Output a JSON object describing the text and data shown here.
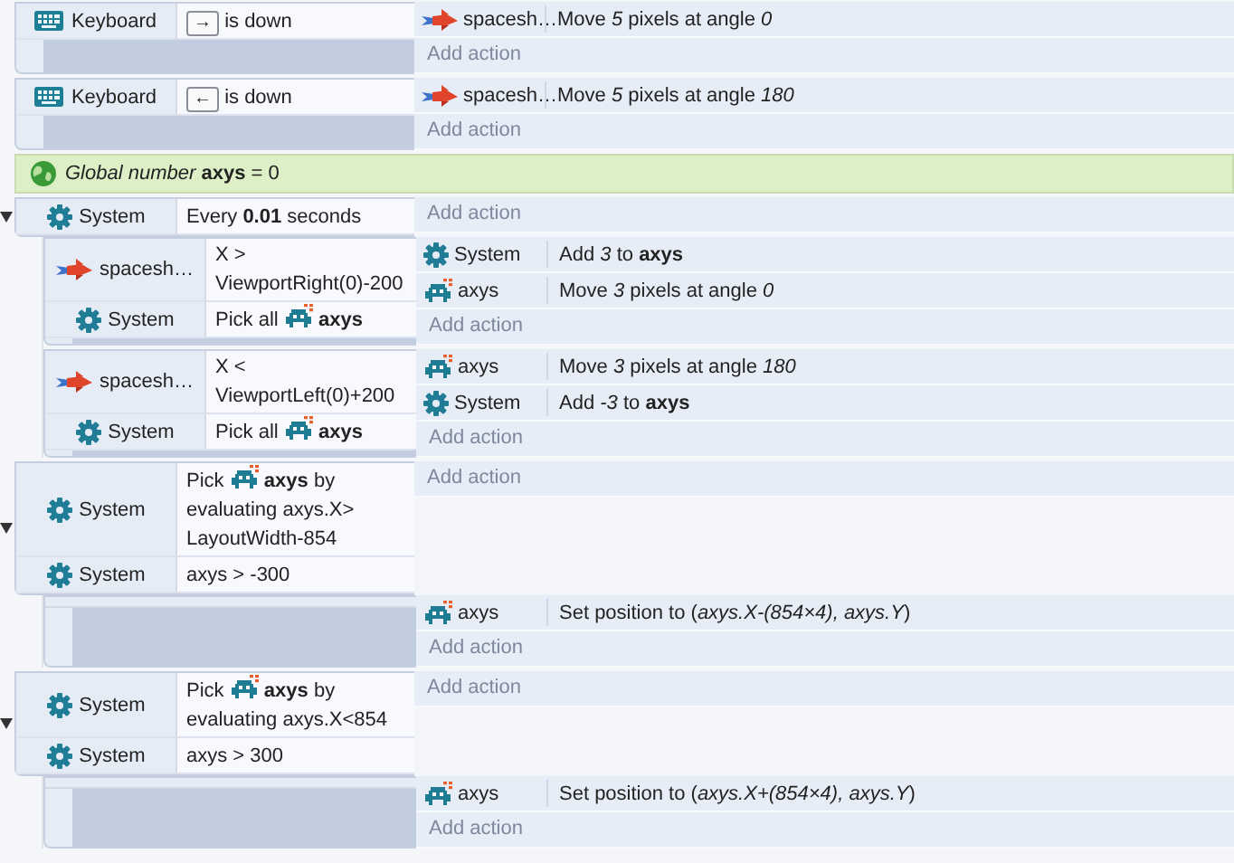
{
  "events": [
    {
      "kind": "event",
      "conditions": [
        {
          "object": "Keyboard",
          "kind": "keyboard",
          "segments": [
            {
              "kind": "key",
              "text": "→"
            },
            {
              "kind": "text",
              "text": "is down"
            }
          ]
        }
      ],
      "actions": [
        {
          "object": "spacesh…",
          "kind": "spaceship",
          "text": "Move *5* pixels at angle *0*"
        }
      ],
      "add_action": "Add action"
    },
    {
      "kind": "event",
      "conditions": [
        {
          "object": "Keyboard",
          "kind": "keyboard",
          "segments": [
            {
              "kind": "key",
              "text": "←"
            },
            {
              "kind": "text",
              "text": "is down"
            }
          ]
        }
      ],
      "actions": [
        {
          "object": "spacesh…",
          "kind": "spaceship",
          "text": "Move *5* pixels at angle *180*"
        }
      ],
      "add_action": "Add action"
    },
    {
      "kind": "variable",
      "text": "*Global number* **axys** = 0"
    },
    {
      "kind": "event",
      "expanded": true,
      "conditions": [
        {
          "object": "System",
          "kind": "system",
          "segments": [
            {
              "kind": "text",
              "text": "Every **0.01** seconds"
            }
          ]
        }
      ],
      "add_action": "Add action",
      "children": [
        {
          "kind": "event",
          "conditions": [
            {
              "object": "spacesh…",
              "kind": "spaceship",
              "segments": [
                {
                  "kind": "text",
                  "text": "X > ViewportRight(0)-200"
                }
              ]
            },
            {
              "object": "System",
              "kind": "system",
              "segments": [
                {
                  "kind": "text",
                  "text": "Pick all"
                },
                {
                  "kind": "invader"
                },
                {
                  "kind": "text",
                  "text": "**axys**"
                }
              ]
            }
          ],
          "actions": [
            {
              "object": "System",
              "kind": "system",
              "text": "Add *3* to **axys**"
            },
            {
              "object": "axys",
              "kind": "invader",
              "text": "Move *3* pixels at angle *0*"
            }
          ],
          "add_action": "Add action"
        },
        {
          "kind": "event",
          "conditions": [
            {
              "object": "spacesh…",
              "kind": "spaceship",
              "segments": [
                {
                  "kind": "text",
                  "text": "X < ViewportLeft(0)+200"
                }
              ]
            },
            {
              "object": "System",
              "kind": "system",
              "segments": [
                {
                  "kind": "text",
                  "text": "Pick all"
                },
                {
                  "kind": "invader"
                },
                {
                  "kind": "text",
                  "text": "**axys**"
                }
              ]
            }
          ],
          "actions": [
            {
              "object": "axys",
              "kind": "invader",
              "text": "Move *3* pixels at angle *180*"
            },
            {
              "object": "System",
              "kind": "system",
              "text": "Add *-3* to **axys**"
            }
          ],
          "add_action": "Add action"
        }
      ]
    },
    {
      "kind": "event",
      "expanded": true,
      "conditions": [
        {
          "object": "System",
          "kind": "system",
          "segments": [
            {
              "kind": "text",
              "text": "Pick"
            },
            {
              "kind": "invader"
            },
            {
              "kind": "text",
              "text": "**axys** by"
            },
            {
              "kind": "line",
              "text": "evaluating axys.X> LayoutWidth-854"
            }
          ]
        },
        {
          "object": "System",
          "kind": "system",
          "segments": [
            {
              "kind": "text",
              "text": "axys > -300"
            }
          ]
        }
      ],
      "add_action": "Add action",
      "children": [
        {
          "kind": "event",
          "actions": [
            {
              "object": "axys",
              "kind": "invader",
              "text": "Set position to (*axys.X-(854×4), axys.Y*)"
            }
          ],
          "add_action": "Add action"
        }
      ]
    },
    {
      "kind": "event",
      "expanded": true,
      "conditions": [
        {
          "object": "System",
          "kind": "system",
          "segments": [
            {
              "kind": "text",
              "text": "Pick"
            },
            {
              "kind": "invader"
            },
            {
              "kind": "text",
              "text": "**axys** by"
            },
            {
              "kind": "line",
              "text": "evaluating axys.X<854"
            }
          ]
        },
        {
          "object": "System",
          "kind": "system",
          "segments": [
            {
              "kind": "text",
              "text": "axys > 300"
            }
          ]
        }
      ],
      "add_action": "Add action",
      "children": [
        {
          "kind": "event",
          "actions": [
            {
              "object": "axys",
              "kind": "invader",
              "text": "Set position to (*axys.X+(854×4), axys.Y*)"
            }
          ],
          "add_action": "Add action"
        }
      ]
    }
  ]
}
